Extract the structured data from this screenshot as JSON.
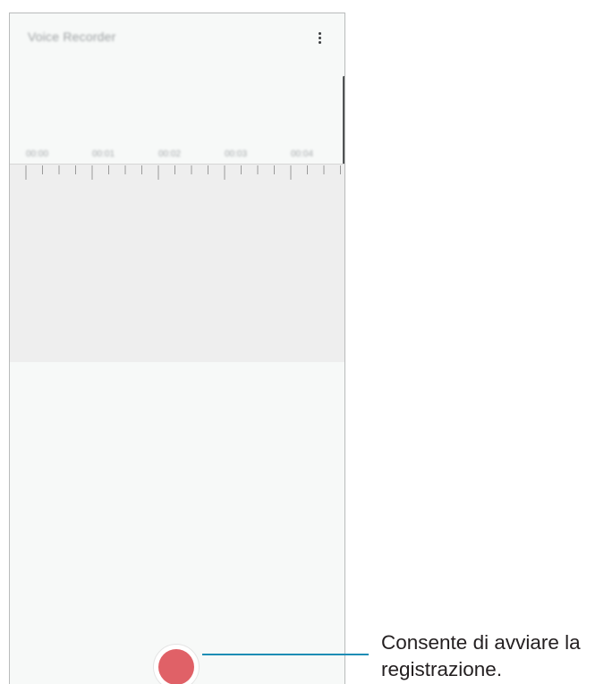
{
  "app": {
    "title": "Voice Recorder"
  },
  "header": {
    "menu_icon": "more-vertical-icon"
  },
  "timeline": {
    "labels": [
      "00:00",
      "00:01",
      "00:02",
      "00:03",
      "00:04"
    ]
  },
  "record": {
    "icon": "record-icon",
    "color": "#e06167"
  },
  "callout": {
    "text_line1": "Consente di avviare la",
    "text_line2": "registrazione.",
    "line_color": "#1d8db5"
  }
}
